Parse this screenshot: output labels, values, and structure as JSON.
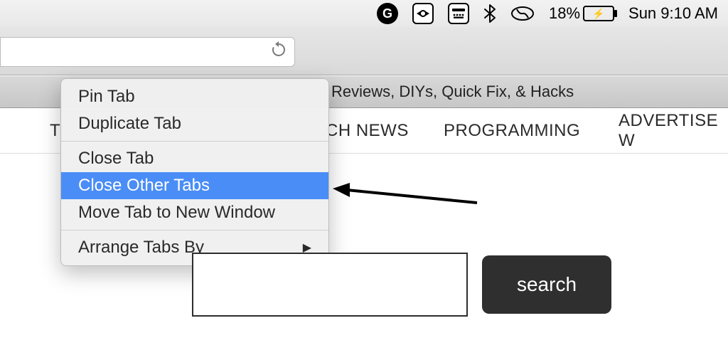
{
  "menubar": {
    "grammarly_icon": "G",
    "teamviewer_icon": "tv",
    "keyboard_icon": "kbd",
    "bluetooth_icon": "bt",
    "loop_icon": "loop",
    "battery_percent": "18%",
    "battery_state": "charging",
    "clock": "Sun 9:10 AM"
  },
  "browser": {
    "reload_label": "reload"
  },
  "tab_title_fragment": "Reviews, DIYs, Quick Fix, & Hacks",
  "nav": {
    "left_stub": "T",
    "tech_fragment": "CH NEWS",
    "programming": "PROGRAMMING",
    "advertise_fragment": "ADVERTISE W"
  },
  "context_menu": {
    "pin": "Pin Tab",
    "duplicate": "Duplicate Tab",
    "close": "Close Tab",
    "close_others": "Close Other Tabs",
    "move_new_window": "Move Tab to New Window",
    "arrange": "Arrange Tabs By"
  },
  "search": {
    "button": "search"
  }
}
